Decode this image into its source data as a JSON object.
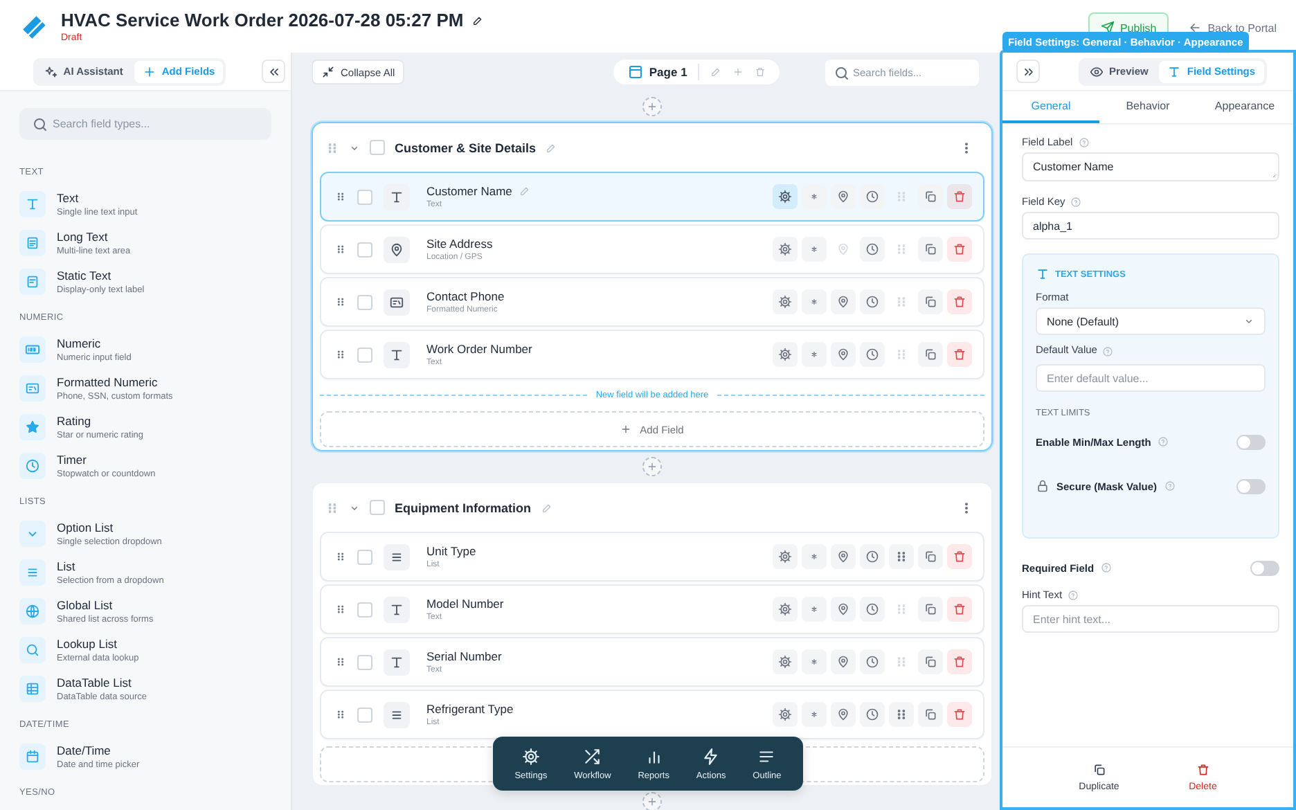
{
  "header": {
    "title": "HVAC Service Work Order 2026-07-28 05:27 PM",
    "status": "Draft",
    "publish": "Publish",
    "back": "Back to Portal"
  },
  "overlay_label": "Field Settings: General · Behavior · Appearance",
  "sidebar": {
    "modes": [
      {
        "kind": "ai",
        "label": "AI Assistant",
        "selected": false
      },
      {
        "kind": "add",
        "label": "Add Fields",
        "selected": true
      }
    ],
    "search_placeholder": "Search field types...",
    "groups": [
      {
        "title": "TEXT",
        "items": [
          {
            "kind": "text",
            "label": "Text",
            "description": "Single line text input"
          },
          {
            "kind": "longtext",
            "label": "Long Text",
            "description": "Multi-line text area"
          },
          {
            "kind": "static",
            "label": "Static Text",
            "description": "Display-only text label"
          }
        ]
      },
      {
        "title": "NUMERIC",
        "items": [
          {
            "kind": "numeric",
            "label": "Numeric",
            "description": "Numeric input field"
          },
          {
            "kind": "formatted",
            "label": "Formatted Numeric",
            "description": "Phone, SSN, custom formats"
          },
          {
            "kind": "rating",
            "label": "Rating",
            "description": "Star or numeric rating"
          },
          {
            "kind": "timer",
            "label": "Timer",
            "description": "Stopwatch or countdown"
          }
        ]
      },
      {
        "title": "LISTS",
        "items": [
          {
            "kind": "option",
            "label": "Option List",
            "description": "Single selection dropdown"
          },
          {
            "kind": "list",
            "label": "List",
            "description": "Selection from a dropdown"
          },
          {
            "kind": "global",
            "label": "Global List",
            "description": "Shared list across forms"
          },
          {
            "kind": "lookup",
            "label": "Lookup List",
            "description": "External data lookup"
          },
          {
            "kind": "datatable",
            "label": "DataTable List",
            "description": "DataTable data source"
          }
        ]
      },
      {
        "title": "DATE/TIME",
        "items": [
          {
            "kind": "datetime",
            "label": "Date/Time",
            "description": "Date and time picker"
          }
        ]
      },
      {
        "title": "YES/NO"
      }
    ]
  },
  "canvas": {
    "collapse_all": "Collapse All",
    "page": "Page 1",
    "search_placeholder": "Search fields...",
    "sections": [
      {
        "title": "Customer & Site Details",
        "selected": true,
        "checked": false,
        "drop_hint": "New field will be added here",
        "add_field": "Add Field",
        "fields": [
          {
            "kind": "text",
            "label": "Customer Name",
            "type": "Text",
            "selected": true,
            "checked": false,
            "location_enabled": true,
            "options_enabled": false
          },
          {
            "kind": "location",
            "label": "Site Address",
            "type": "Location / GPS",
            "selected": false,
            "checked": false,
            "location_enabled": false,
            "options_enabled": false
          },
          {
            "kind": "formatted",
            "label": "Contact Phone",
            "type": "Formatted Numeric",
            "selected": false,
            "checked": false,
            "location_enabled": true,
            "options_enabled": false
          },
          {
            "kind": "text",
            "label": "Work Order Number",
            "type": "Text",
            "selected": false,
            "checked": false,
            "location_enabled": true,
            "options_enabled": false
          }
        ]
      },
      {
        "title": "Equipment Information",
        "selected": false,
        "checked": false,
        "fields": [
          {
            "kind": "list",
            "label": "Unit Type",
            "type": "List",
            "selected": false,
            "checked": false,
            "location_enabled": true,
            "options_enabled": true
          },
          {
            "kind": "text",
            "label": "Model Number",
            "type": "Text",
            "selected": false,
            "checked": false,
            "location_enabled": true,
            "options_enabled": false
          },
          {
            "kind": "text",
            "label": "Serial Number",
            "type": "Text",
            "selected": false,
            "checked": false,
            "location_enabled": true,
            "options_enabled": false
          },
          {
            "kind": "list",
            "label": "Refrigerant Type",
            "type": "List",
            "selected": false,
            "checked": false,
            "location_enabled": true,
            "options_enabled": true
          }
        ]
      }
    ]
  },
  "dock": [
    {
      "kind": "settings",
      "label": "Settings"
    },
    {
      "kind": "workflow",
      "label": "Workflow"
    },
    {
      "kind": "reports",
      "label": "Reports"
    },
    {
      "kind": "actions",
      "label": "Actions"
    },
    {
      "kind": "outline",
      "label": "Outline"
    }
  ],
  "panel": {
    "modes": [
      {
        "kind": "preview",
        "label": "Preview",
        "selected": false
      },
      {
        "kind": "settings",
        "label": "Field Settings",
        "selected": true
      }
    ],
    "tabs": [
      {
        "label": "General",
        "selected": true
      },
      {
        "label": "Behavior",
        "selected": false
      },
      {
        "label": "Appearance",
        "selected": false
      }
    ],
    "field_label": {
      "label": "Field Label",
      "value": "Customer Name"
    },
    "field_key": {
      "label": "Field Key",
      "value": "alpha_1"
    },
    "text_settings": {
      "title": "TEXT SETTINGS",
      "format": {
        "label": "Format",
        "value": "None (Default)"
      },
      "default_value": {
        "label": "Default Value",
        "placeholder": "Enter default value..."
      },
      "limits_title": "TEXT LIMITS",
      "toggles": [
        {
          "kind": "plain",
          "label": "Enable Min/Max Length",
          "on": false
        },
        {
          "kind": "locked",
          "label": "Secure (Mask Value)",
          "on": false
        }
      ]
    },
    "required": {
      "label": "Required Field",
      "on": false
    },
    "hint": {
      "label": "Hint Text",
      "placeholder": "Enter hint text..."
    },
    "footer": [
      {
        "kind": "duplicate",
        "label": "Duplicate"
      },
      {
        "kind": "delete",
        "label": "Delete"
      }
    ]
  }
}
